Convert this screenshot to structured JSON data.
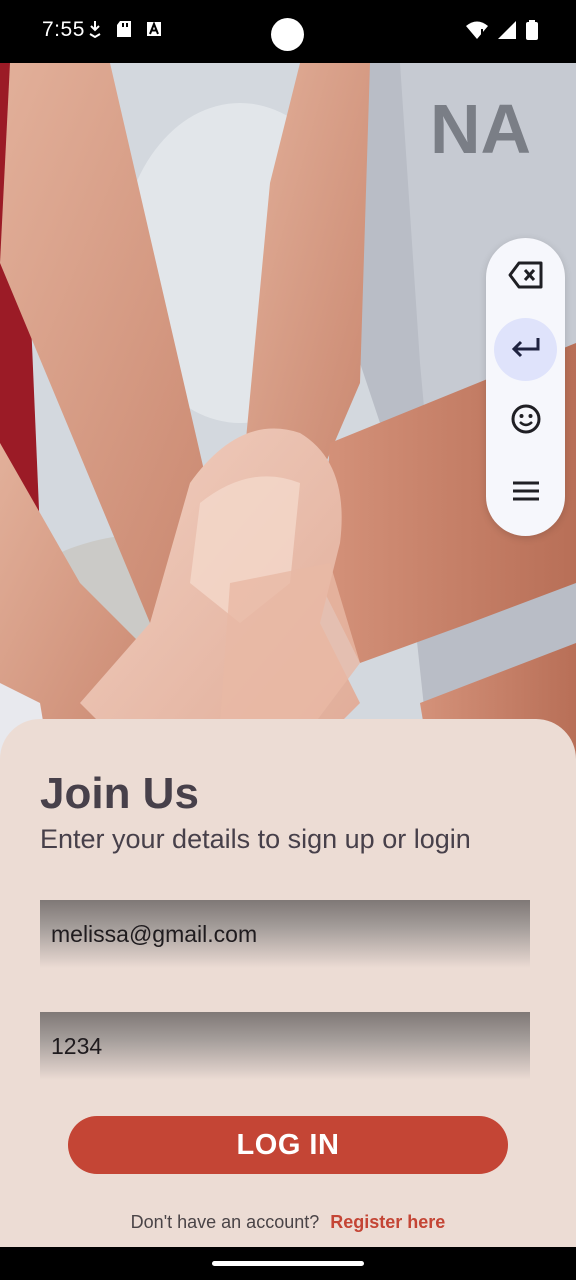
{
  "status_bar": {
    "time": "7:55",
    "left_icons": [
      "download-icon",
      "sd-card-icon",
      "keyboard-a-icon"
    ],
    "right_icons": [
      "wifi-icon",
      "signal-icon",
      "battery-icon"
    ]
  },
  "floating_keyboard": {
    "buttons": [
      "backspace-icon",
      "enter-icon",
      "emoji-icon",
      "menu-icon"
    ],
    "active_button": "enter-icon"
  },
  "login": {
    "title": "Join Us",
    "subtitle": "Enter your details to sign up or login",
    "email_value": "melissa@gmail.com",
    "password_value": "1234",
    "login_label": "LOG IN",
    "no_account_text": "Don't have an account?",
    "register_link": "Register here"
  },
  "colors": {
    "accent": "#c44535",
    "card_background": "#ecdcd4",
    "text": "#47404a",
    "keyboard_active": "#dfe3fb"
  }
}
